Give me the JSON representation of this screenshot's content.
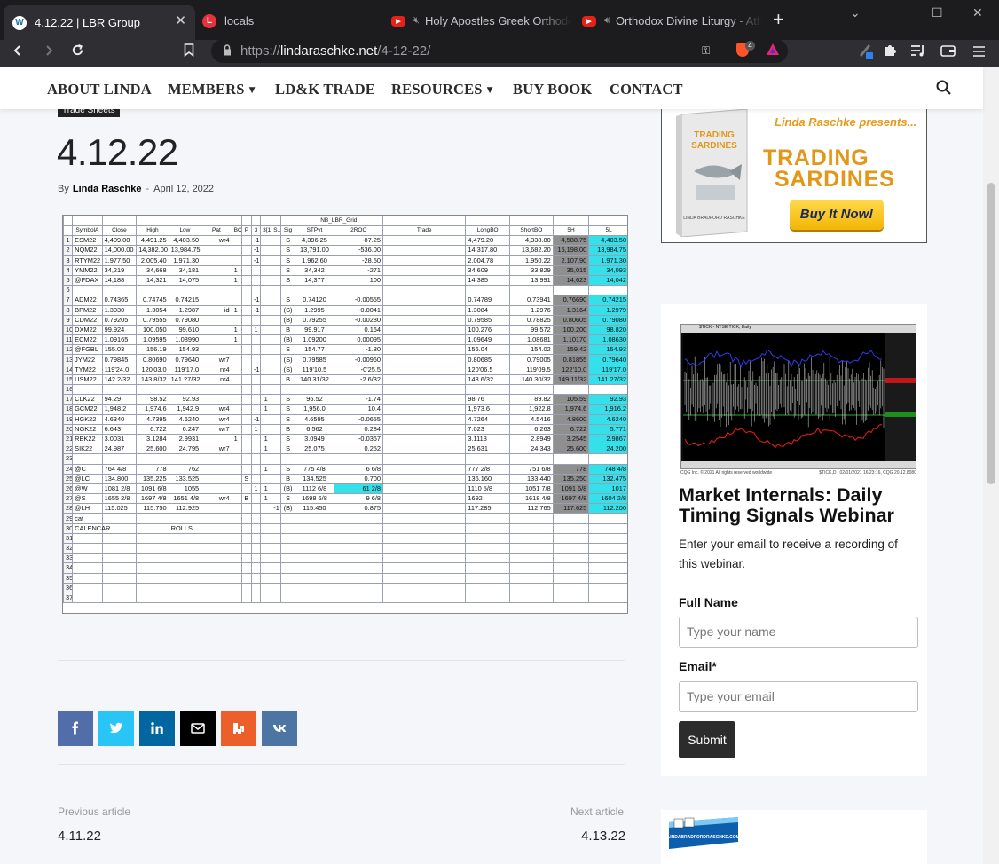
{
  "browser": {
    "tabs": [
      {
        "title": "4.12.22 | LBR Group",
        "favicon": "W"
      },
      {
        "title": "locals",
        "favicon": "L"
      },
      {
        "title": "Holy Apostles Greek Orthodox",
        "favicon": "▶"
      },
      {
        "title": "Orthodox Divine Liturgy - Ath",
        "favicon": "▶"
      }
    ],
    "url_prefix": "https://",
    "url_host": "lindaraschke.net",
    "url_path": "/4-12-22/",
    "shield_count": "4"
  },
  "nav": {
    "items": [
      "ABOUT LINDA",
      "MEMBERS",
      "LD&K TRADE",
      "RESOURCES",
      "BUY BOOK",
      "CONTACT"
    ]
  },
  "post": {
    "category": "Trade Sheets",
    "title": "4.12.22",
    "by": "By",
    "author": "Linda Raschke",
    "sep": "-",
    "date": "April 12, 2022"
  },
  "sheet": {
    "title": "NB_LBR_Grid",
    "headers": [
      "SymbolA",
      "Close",
      "High",
      "Low",
      "Pat",
      "BO",
      "P",
      "3",
      "3[1]",
      "S...",
      "Sig",
      "STPvt",
      "2ROC",
      "Trade",
      "LongBO",
      "ShortBO",
      "5H",
      "5L"
    ],
    "rows": [
      [
        "1",
        "ESM22",
        "4,409.00",
        "4,491.25",
        "4,403.50",
        "wr4",
        "",
        "",
        "-1",
        "",
        "",
        "S",
        "4,396.25",
        "-87.25",
        "",
        "4,479.20",
        "4,338.80",
        "4,588.75",
        "4,403.50"
      ],
      [
        "2",
        "NQM22",
        "14,000.00",
        "14,382.00",
        "13,984.75",
        "",
        "",
        "",
        "-1",
        "",
        "",
        "S",
        "13,791.00",
        "-536.00",
        "",
        "14,317.80",
        "13,682.20",
        "15,198.00",
        "13,984.75"
      ],
      [
        "3",
        "RTYM22",
        "1,977.50",
        "2,005.40",
        "1,971.30",
        "",
        "",
        "",
        "-1",
        "",
        "",
        "S",
        "1,962.60",
        "-28.50",
        "",
        "2,004.78",
        "1,950.22",
        "2,107.90",
        "1,971.30"
      ],
      [
        "4",
        "YMM22",
        "34,219",
        "34,668",
        "34,181",
        "",
        "1",
        "",
        "",
        "",
        "",
        "S",
        "34,342",
        "-271",
        "",
        "34,609",
        "33,829",
        "35,015",
        "34,093"
      ],
      [
        "5",
        "@FDAX",
        "14,188",
        "14,321",
        "14,075",
        "",
        "1",
        "",
        "",
        "",
        "",
        "S",
        "14,377",
        "100",
        "",
        "14,385",
        "13,991",
        "14,623",
        "14,042"
      ],
      [
        "6",
        "",
        "",
        "",
        "",
        "",
        "",
        "",
        "",
        "",
        "",
        "",
        "",
        "",
        "",
        "",
        "",
        "",
        ""
      ],
      [
        "7",
        "ADM22",
        "0.74365",
        "0.74745",
        "0.74215",
        "",
        "",
        "",
        "-1",
        "",
        "",
        "S",
        "0.74120",
        "-0.00555",
        "",
        "0.74789",
        "0.73941",
        "0.76690",
        "0.74215"
      ],
      [
        "8",
        "BPM22",
        "1.3030",
        "1.3054",
        "1.2987",
        "id",
        "1",
        "",
        "-1",
        "",
        "",
        "(S)",
        "1.2995",
        "-0.0041",
        "",
        "1.3084",
        "1.2976",
        "1.3164",
        "1.2979"
      ],
      [
        "9",
        "CDM22",
        "0.79205",
        "0.79555",
        "0.79080",
        "",
        "",
        "",
        "",
        "",
        "",
        "(B)",
        "0.79255",
        "-0.00280",
        "",
        "0.79585",
        "0.78825",
        "0.80605",
        "0.79080"
      ],
      [
        "10",
        "DXM22",
        "99.924",
        "100.050",
        "99.610",
        "",
        "1",
        "",
        "1",
        "",
        "",
        "B",
        "99.917",
        "0.164",
        "",
        "100.276",
        "99.572",
        "100.200",
        "98.820"
      ],
      [
        "11",
        "ECM22",
        "1.09165",
        "1.09595",
        "1.08990",
        "",
        "1",
        "",
        "",
        "",
        "",
        "(B)",
        "1.09200",
        "0.00095",
        "",
        "1.09649",
        "1.08681",
        "1.10170",
        "1.08630"
      ],
      [
        "12",
        "@FGBL",
        "155.03",
        "156.19",
        "154.93",
        "",
        "",
        "",
        "",
        "",
        "",
        "S",
        "154.77",
        "-1.80",
        "",
        "156.04",
        "154.02",
        "159.42",
        "154.93"
      ],
      [
        "13",
        "JYM22",
        "0.79845",
        "0.80690",
        "0.79640",
        "wr7",
        "",
        "",
        "",
        "",
        "",
        "(S)",
        "0.79585",
        "-0.00960",
        "",
        "0.80685",
        "0.79005",
        "0.81855",
        "0.79640"
      ],
      [
        "14",
        "TYM22",
        "119'24.0",
        "120'03.0",
        "119'17.0",
        "nr4",
        "",
        "",
        "-1",
        "",
        "",
        "(S)",
        "119'10.5",
        "-0'25.5",
        "",
        "120'06.5",
        "119'09.5",
        "122'10.0",
        "119'17.0"
      ],
      [
        "15",
        "USM22",
        "142 2/32",
        "143 8/32",
        "141 27/32",
        "nr4",
        "",
        "",
        "",
        "",
        "",
        "B",
        "140 31/32",
        "-2 6/32",
        "",
        "143 6/32",
        "140 30/32",
        "149 11/32",
        "141 27/32"
      ],
      [
        "16",
        "",
        "",
        "",
        "",
        "",
        "",
        "",
        "",
        "",
        "",
        "",
        "",
        "",
        "",
        "",
        "",
        "",
        ""
      ],
      [
        "17",
        "CLK22",
        "94.29",
        "98.52",
        "92.93",
        "",
        "",
        "",
        "",
        "1",
        "",
        "S",
        "96.52",
        "-1.74",
        "",
        "98.76",
        "89.82",
        "105.59",
        "92.93"
      ],
      [
        "18",
        "GCM22",
        "1,948.2",
        "1,974.6",
        "1,942.9",
        "wr4",
        "",
        "",
        "",
        "1",
        "",
        "S",
        "1,956.0",
        "10.4",
        "",
        "1,973.6",
        "1,922.8",
        "1,974.6",
        "1,916.2"
      ],
      [
        "19",
        "HGK22",
        "4.6340",
        "4.7395",
        "4.6240",
        "wr4",
        "",
        "",
        "-1",
        "",
        "",
        "S",
        "4.6595",
        "-0.0655",
        "",
        "4.7264",
        "4.5416",
        "4.8600",
        "4.6240"
      ],
      [
        "20",
        "NGK22",
        "6.643",
        "6.722",
        "6.247",
        "wr7",
        "",
        "",
        "1",
        "",
        "",
        "B",
        "6.562",
        "0.284",
        "",
        "7.023",
        "6.263",
        "6.722",
        "5.771"
      ],
      [
        "21",
        "RBK22",
        "3.0031",
        "3.1284",
        "2.9931",
        "",
        "1",
        "",
        "",
        "1",
        "",
        "S",
        "3.0949",
        "-0.0367",
        "",
        "3.1113",
        "2.8949",
        "3.2545",
        "2.9867"
      ],
      [
        "22",
        "SIK22",
        "24.987",
        "25.600",
        "24.795",
        "wr7",
        "",
        "",
        "",
        "1",
        "",
        "S",
        "25.075",
        "0.252",
        "",
        "25.631",
        "24.343",
        "25.600",
        "24.200"
      ],
      [
        "23",
        "",
        "",
        "",
        "",
        "",
        "",
        "",
        "",
        "",
        "",
        "",
        "",
        "",
        "",
        "",
        "",
        "",
        ""
      ],
      [
        "24",
        "@C",
        "764 4/8",
        "778",
        "762",
        "",
        "",
        "",
        "",
        "1",
        "",
        "S",
        "775 4/8",
        "6 6/8",
        "",
        "777 2/8",
        "751 6/8",
        "778",
        "748 4/8"
      ],
      [
        "25",
        "@LC",
        "134.800",
        "135.225",
        "133.525",
        "",
        "",
        "S",
        "",
        "",
        "",
        "B",
        "134.525",
        "0.700",
        "",
        "136.160",
        "133.440",
        "135.250",
        "132.475"
      ],
      [
        "26",
        "@W",
        "1081 2/8",
        "1091 6/8",
        "1055",
        "",
        "",
        "",
        "1",
        "1",
        "",
        "(B)",
        "1112 6/8",
        "61 2/8",
        "",
        "1110 5/8",
        "1051 7/8",
        "1091 6/8",
        "1017"
      ],
      [
        "27",
        "@S",
        "1655 2/8",
        "1697 4/8",
        "1651 4/8",
        "wr4",
        "",
        "B",
        "",
        "1",
        "",
        "S",
        "1698 6/8",
        "9 6/8",
        "",
        "1692",
        "1618 4/8",
        "1697 4/8",
        "1604 2/8"
      ],
      [
        "28",
        "@LH",
        "115.025",
        "115.750",
        "112.925",
        "",
        "",
        "",
        "",
        "",
        "-1",
        "(B)",
        "115.450",
        "0.875",
        "",
        "117.285",
        "112.765",
        "117.625",
        "112.200"
      ],
      [
        "29",
        "cat",
        "",
        "",
        "",
        "",
        "",
        "",
        "",
        "",
        "",
        "",
        "",
        "",
        "",
        "",
        "",
        "",
        ""
      ],
      [
        "30",
        "CALENCAR",
        "",
        "",
        "ROLLS",
        "",
        "",
        "",
        "",
        "",
        "",
        "",
        "",
        "",
        "",
        "",
        "",
        "",
        ""
      ],
      [
        "31",
        "",
        "",
        "",
        "",
        "",
        "",
        "",
        "",
        "",
        "",
        "",
        "",
        "",
        "",
        "",
        "",
        "",
        ""
      ],
      [
        "32",
        "",
        "",
        "",
        "",
        "",
        "",
        "",
        "",
        "",
        "",
        "",
        "",
        "",
        "",
        "",
        "",
        "",
        ""
      ],
      [
        "33",
        "",
        "",
        "",
        "",
        "",
        "",
        "",
        "",
        "",
        "",
        "",
        "",
        "",
        "",
        "",
        "",
        "",
        ""
      ],
      [
        "34",
        "",
        "",
        "",
        "",
        "",
        "",
        "",
        "",
        "",
        "",
        "",
        "",
        "",
        "",
        "",
        "",
        "",
        ""
      ],
      [
        "35",
        "",
        "",
        "",
        "",
        "",
        "",
        "",
        "",
        "",
        "",
        "",
        "",
        "",
        "",
        "",
        "",
        "",
        ""
      ],
      [
        "36",
        "",
        "",
        "",
        "",
        "",
        "",
        "",
        "",
        "",
        "",
        "",
        "",
        "",
        "",
        "",
        "",
        "",
        ""
      ],
      [
        "37",
        "",
        "",
        "",
        "",
        "",
        "",
        "",
        "",
        "",
        "",
        "",
        "",
        "",
        "",
        "",
        "",
        "",
        ""
      ]
    ],
    "gray_5h_rows": [
      "1",
      "2",
      "3",
      "4",
      "5",
      "7",
      "8",
      "9",
      "10",
      "11",
      "12",
      "13",
      "14",
      "15",
      "17",
      "18",
      "19",
      "20",
      "21",
      "22",
      "24",
      "25",
      "26",
      "27",
      "28"
    ],
    "cyan_5l_rows": [
      "1",
      "2",
      "3",
      "4",
      "5",
      "7",
      "8",
      "9",
      "10",
      "11",
      "12",
      "13",
      "14",
      "15",
      "17",
      "18",
      "19",
      "20",
      "21",
      "22",
      "24",
      "25",
      "26",
      "27",
      "28"
    ],
    "cyan_2roc_rows": [
      "26"
    ]
  },
  "share": {
    "buttons": [
      {
        "name": "facebook",
        "color": "#516eab"
      },
      {
        "name": "twitter",
        "color": "#29c5f6"
      },
      {
        "name": "linkedin",
        "color": "#0266a0"
      },
      {
        "name": "email",
        "color": "#000000"
      },
      {
        "name": "mix",
        "color": "#ed5f2a"
      },
      {
        "name": "vk",
        "color": "#4c75a3"
      }
    ]
  },
  "article_nav": {
    "prev_label": "Previous article",
    "next_label": "Next article",
    "prev_title": "4.11.22",
    "next_title": "4.13.22"
  },
  "book_ad": {
    "presents": "Linda Raschke presents...",
    "title_line1": "TRADING",
    "title_line2": "SARDINES",
    "button": "Buy It Now!",
    "book_title": "TRADING SARDINES"
  },
  "webinar": {
    "chart_header": "$TICK - NYSE TICK, Daily",
    "caption_left": "CQG Inc. © 2021 All rights reserved worldwide",
    "caption_right": "$TICK,D | 02/01/2021 16:23:16, CQG 20.12.8080",
    "title": "Market Internals: Daily Timing Signals Webinar",
    "description": "Enter your email to receive a recording of this webinar.",
    "name_label": "Full Name",
    "name_placeholder": "Type your name",
    "email_label": "Email*",
    "email_placeholder": "Type your email",
    "submit": "Submit"
  },
  "logo_widget": {
    "text": "LINDABRADFORDRASCHKE.COM"
  },
  "colors": {
    "accent_link": "#1b4b7a",
    "sheet_gray": "#8f8f8f",
    "sheet_cyan": "#34e0ea",
    "ad_orange": "#e39719"
  }
}
